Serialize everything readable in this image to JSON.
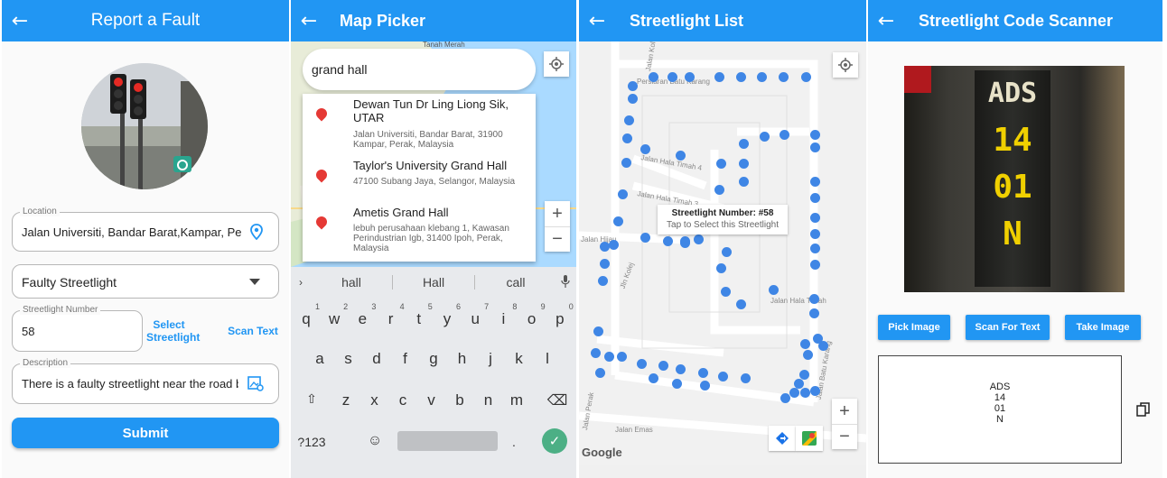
{
  "report": {
    "title": "Report a Fault",
    "location_label": "Location",
    "location_value": "Jalan Universiti, Bandar Barat,Kampar, Pera",
    "fault_type": "Faulty Streetlight",
    "streetlight_label": "Streetlight Number",
    "streetlight_value": "58",
    "select_streetlight": "Select Streetlight",
    "scan_text": "Scan Text",
    "description_label": "Description",
    "description_value": "There is a faulty streetlight near the road be",
    "submit": "Submit"
  },
  "picker": {
    "title": "Map Picker",
    "search_value": "grand hall",
    "map_label": "Tanah Merah",
    "suggestions": [
      {
        "name": "Dewan Tun Dr Ling Liong Sik, UTAR",
        "address": "Jalan Universiti, Bandar Barat, 31900 Kampar, Perak, Malaysia"
      },
      {
        "name": "Taylor's University Grand Hall",
        "address": "47100 Subang Jaya, Selangor, Malaysia"
      },
      {
        "name": "Ametis Grand Hall",
        "address": "lebuh perusahaan klebang 1, Kawasan Perindustrian Igb, 31400 Ipoh, Perak, Malaysia"
      }
    ],
    "kb_suggestions": [
      "hall",
      "Hall",
      "call"
    ],
    "row1": [
      "q",
      "w",
      "e",
      "r",
      "t",
      "y",
      "u",
      "i",
      "o",
      "p"
    ],
    "row1_nums": [
      "1",
      "2",
      "3",
      "4",
      "5",
      "6",
      "7",
      "8",
      "9",
      "0"
    ],
    "row2": [
      "a",
      "s",
      "d",
      "f",
      "g",
      "h",
      "j",
      "k",
      "l"
    ],
    "row3": [
      "z",
      "x",
      "c",
      "v",
      "b",
      "n",
      "m"
    ],
    "symbols_key": "?123",
    "period_key": "."
  },
  "list": {
    "title": "Streetlight List",
    "tooltip_title": "Streetlight Number: #58",
    "tooltip_sub": "Tap to Select this Streetlight",
    "streets": [
      "Jalan Kolej",
      "Persiaran Batu Karang",
      "Jalan Hala Timah 4",
      "Jalan Hala Timah 3",
      "Jalan Hijau",
      "Jln Kolej",
      "Jalan Hala Timah",
      "Jalan Batu Karang",
      "Jalan Emas",
      "Jalan Perak"
    ],
    "google": "Google"
  },
  "scanner": {
    "title": "Streetlight Code Scanner",
    "plate_lines": [
      "ADS",
      "14",
      "01",
      "N"
    ],
    "pick_image": "Pick Image",
    "scan_for_text": "Scan For Text",
    "take_image": "Take Image",
    "result_lines": [
      "ADS",
      "14",
      "01",
      "N"
    ]
  },
  "colors": {
    "primary": "#2196f3",
    "marker": "#3f86e5",
    "pin": "#e53935"
  }
}
